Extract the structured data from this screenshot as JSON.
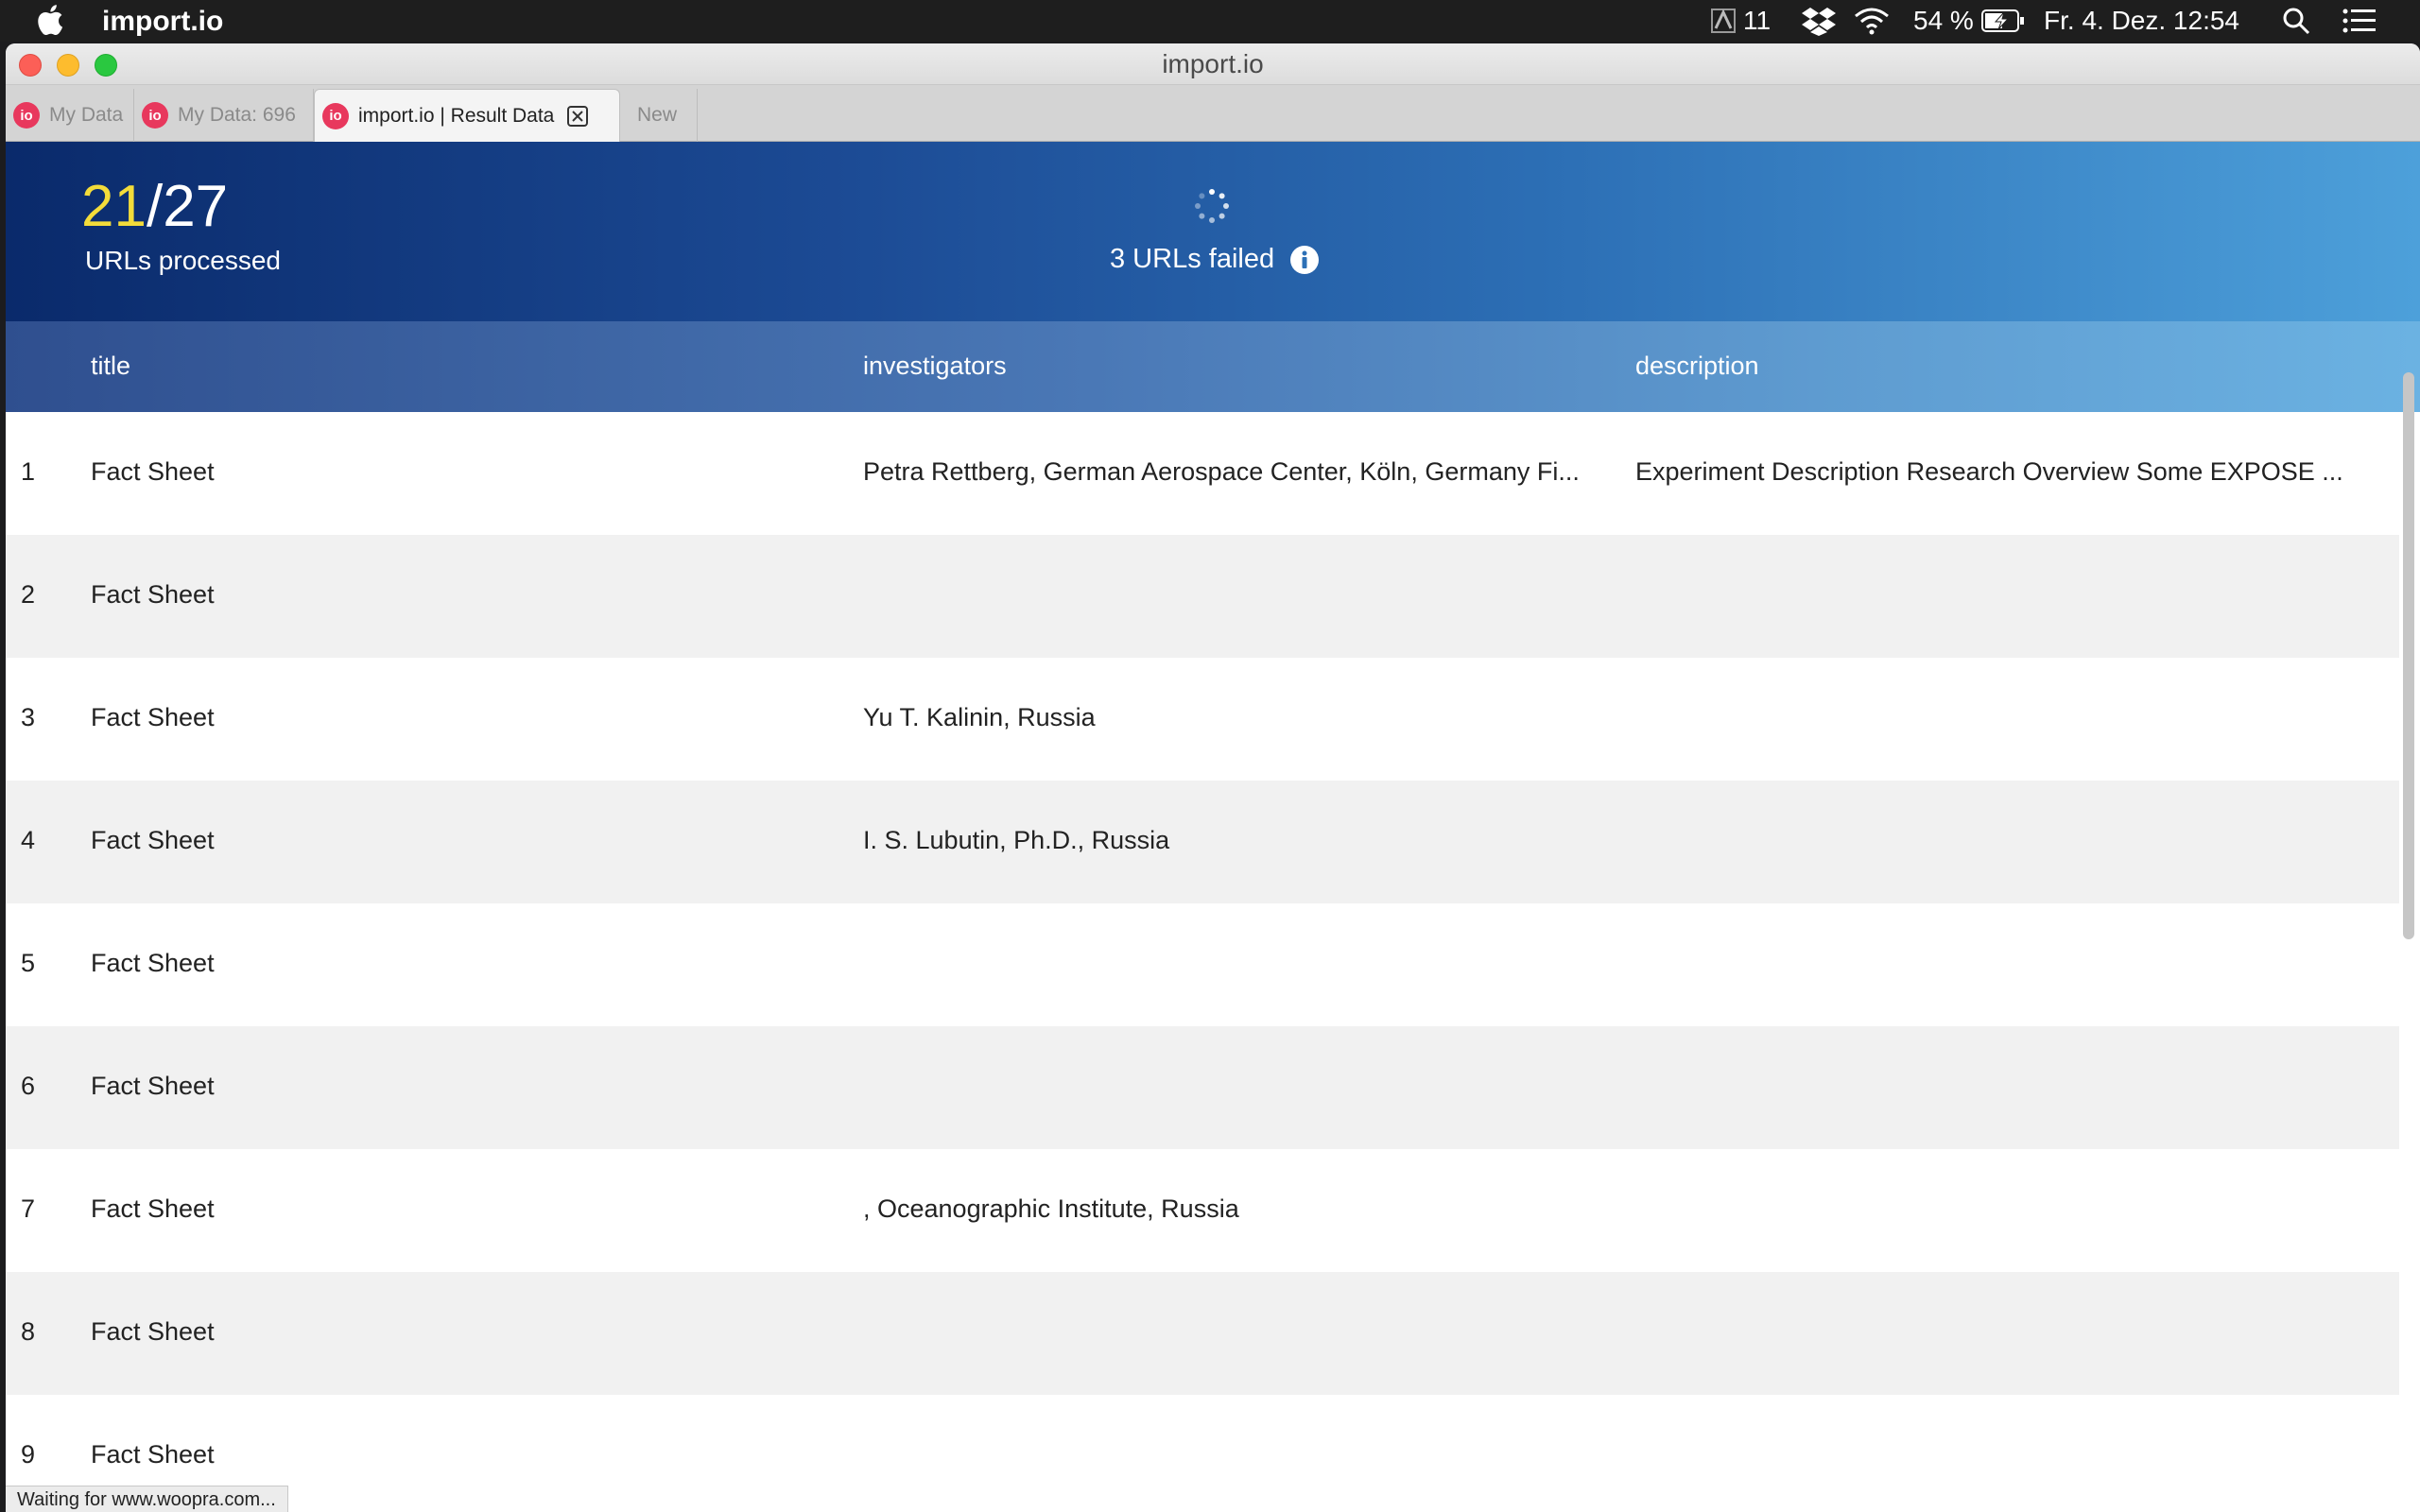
{
  "menubar": {
    "app_name": "import.io",
    "adobe_count": "11",
    "battery": "54 %",
    "datetime": "Fr. 4. Dez.  12:54"
  },
  "window": {
    "title": "import.io"
  },
  "tabs": [
    {
      "label": "My Data",
      "icon_text": "io"
    },
    {
      "label": "My Data: 696",
      "icon_text": "io"
    },
    {
      "label": "import.io | Result Data",
      "icon_text": "io"
    },
    {
      "label": "New"
    }
  ],
  "banner": {
    "processed": "21",
    "separator": "/",
    "total": "27",
    "processed_label": "URLs processed",
    "failed_text": "3 URLs failed"
  },
  "table": {
    "columns": [
      "title",
      "investigators",
      "description"
    ],
    "rows": [
      {
        "num": "1",
        "title": "Fact Sheet",
        "investigators": "Petra Rettberg, German Aerospace Center, Köln, Germany Fi...",
        "description": "Experiment Description Research Overview Some EXPOSE ..."
      },
      {
        "num": "2",
        "title": "Fact Sheet",
        "investigators": "",
        "description": ""
      },
      {
        "num": "3",
        "title": "Fact Sheet",
        "investigators": "Yu T. Kalinin, Russia",
        "description": ""
      },
      {
        "num": "4",
        "title": "Fact Sheet",
        "investigators": "I. S. Lubutin, Ph.D., Russia",
        "description": ""
      },
      {
        "num": "5",
        "title": "Fact Sheet",
        "investigators": "",
        "description": ""
      },
      {
        "num": "6",
        "title": "Fact Sheet",
        "investigators": "",
        "description": ""
      },
      {
        "num": "7",
        "title": "Fact Sheet",
        "investigators": ", Oceanographic Institute, Russia",
        "description": ""
      },
      {
        "num": "8",
        "title": "Fact Sheet",
        "investigators": "",
        "description": ""
      },
      {
        "num": "9",
        "title": "Fact Sheet",
        "investigators": "",
        "description": ""
      }
    ]
  },
  "statusbar": {
    "text": "Waiting for www.woopra.com..."
  },
  "colors": {
    "accent_yellow": "#f3dc3a",
    "io_brand": "#e8385d",
    "banner_dark": "#0a2a6b",
    "banner_light": "#4da0da"
  }
}
